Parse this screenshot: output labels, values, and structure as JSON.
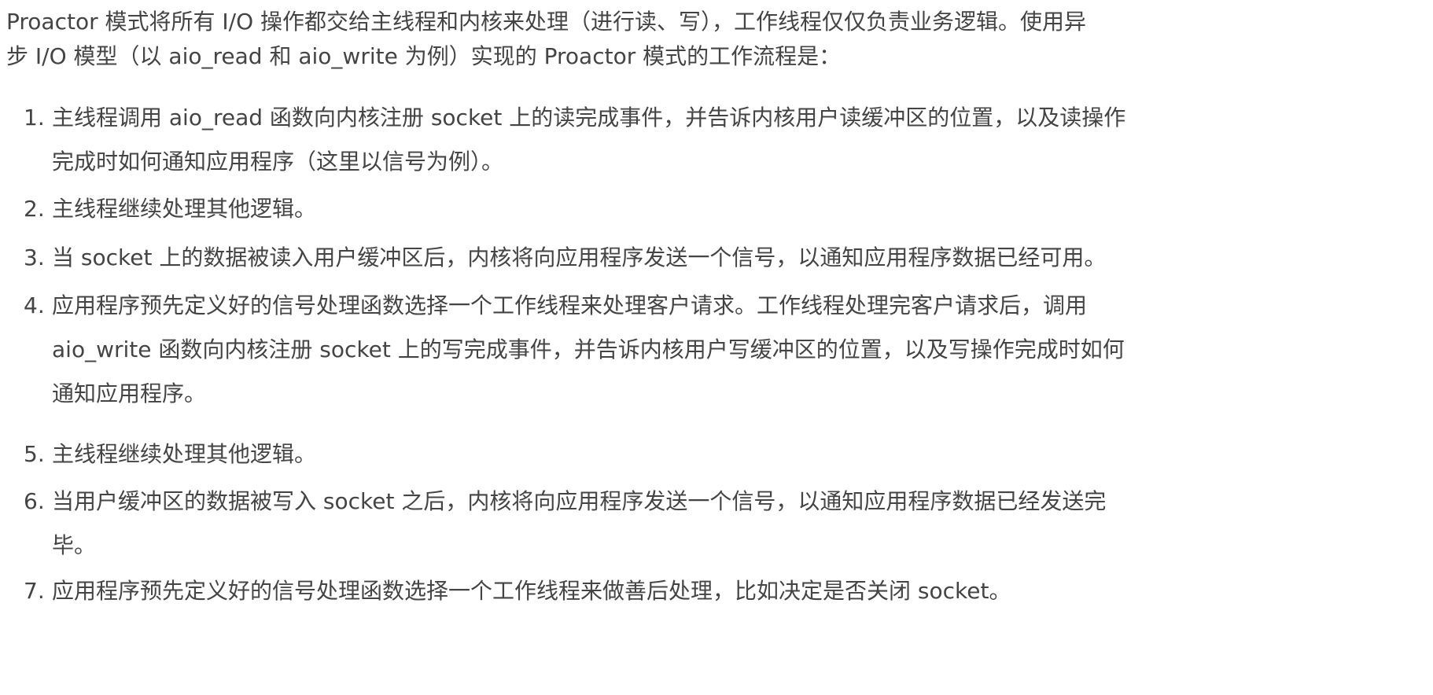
{
  "intro": {
    "lines": [
      "Proactor 模式将所有 I/O 操作都交给主线程和内核来处理（进行读、写），工作线程仅仅负责业务逻辑。使用异",
      "步 I/O 模型（以 aio_read 和 aio_write 为例）实现的 Proactor 模式的工作流程是："
    ]
  },
  "steps": [
    {
      "num": "1.",
      "lines": [
        "主线程调用 aio_read 函数向内核注册 socket 上的读完成事件，并告诉内核用户读缓冲区的位置，以及读操作",
        "完成时如何通知应用程序（这里以信号为例）。"
      ]
    },
    {
      "num": "2.",
      "lines": [
        "主线程继续处理其他逻辑。"
      ]
    },
    {
      "num": "3.",
      "lines": [
        "当 socket 上的数据被读入用户缓冲区后，内核将向应用程序发送一个信号，以通知应用程序数据已经可用。"
      ]
    },
    {
      "num": "4.",
      "lines": [
        "应用程序预先定义好的信号处理函数选择一个工作线程来处理客户请求。工作线程处理完客户请求后，调用",
        "aio_write 函数向内核注册 socket 上的写完成事件，并告诉内核用户写缓冲区的位置，以及写操作完成时如何",
        "通知应用程序。"
      ]
    },
    {
      "num": "5.",
      "lines": [
        "主线程继续处理其他逻辑。"
      ]
    },
    {
      "num": "6.",
      "lines": [
        "当用户缓冲区的数据被写入 socket 之后，内核将向应用程序发送一个信号，以通知应用程序数据已经发送完",
        "毕。"
      ]
    },
    {
      "num": "7.",
      "lines": [
        "应用程序预先定义好的信号处理函数选择一个工作线程来做善后处理，比如决定是否关闭 socket。"
      ]
    }
  ]
}
